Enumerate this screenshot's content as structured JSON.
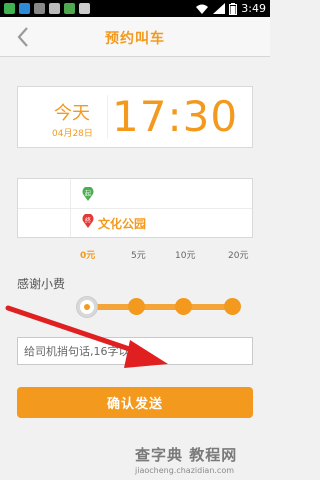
{
  "statusbar": {
    "time": "3:49",
    "icons": [
      "wechat-icon",
      "image-icon",
      "phone-icon",
      "usb-icon",
      "shield-icon",
      "mail-icon",
      "wifi-icon",
      "signal-icon",
      "battery-icon"
    ]
  },
  "navbar": {
    "title": "预约叫车",
    "back_icon": "chevron-left-icon"
  },
  "time_card": {
    "day": "今天",
    "date": "04月28日",
    "clock": "17:30"
  },
  "route": {
    "start_marker": "起",
    "end_marker": "终",
    "start_value": "",
    "end_value": "文化公园"
  },
  "tip": {
    "label": "感谢小费",
    "options": [
      "0元",
      "5元",
      "10元",
      "20元"
    ],
    "selected_index": 0
  },
  "message": {
    "placeholder": "给司机捎句话,16字以内"
  },
  "confirm": {
    "label": "确认发送"
  },
  "watermark": {
    "text": "查字典 教程网",
    "url": "jiaocheng.chazidian.com"
  },
  "colors": {
    "accent": "#f39a1e",
    "start_pin": "#4caf50",
    "end_pin": "#e53935",
    "arrow": "#e02020"
  }
}
